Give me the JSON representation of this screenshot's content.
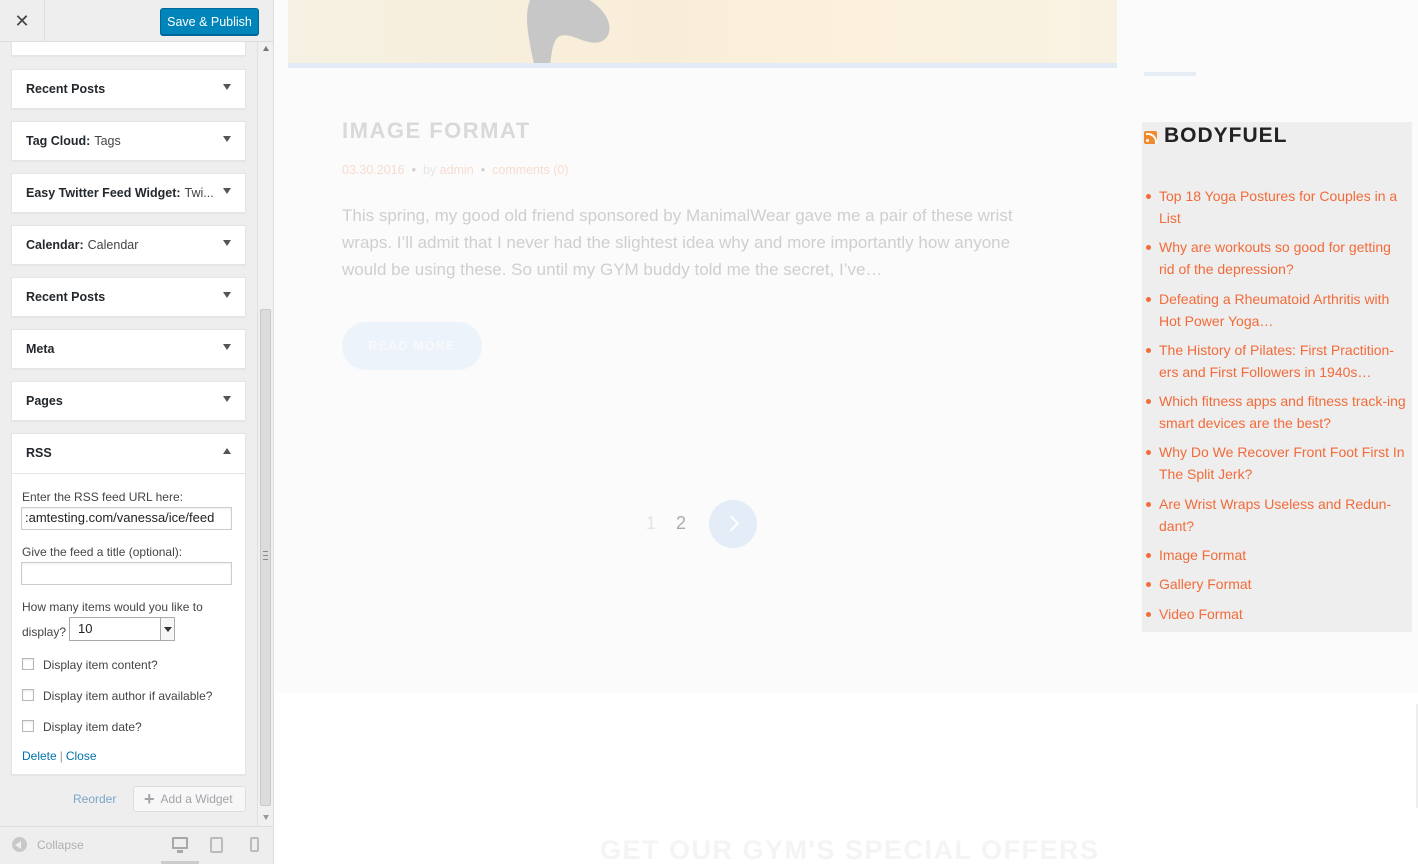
{
  "topbar": {
    "close_glyph": "✕",
    "save_label": "Save & Publish"
  },
  "widgets": [
    {
      "title": "Recent Posts",
      "subtitle": ""
    },
    {
      "title": "Tag Cloud:",
      "subtitle": "Tags"
    },
    {
      "title": "Easy Twitter Feed Widget:",
      "subtitle": "Twi..."
    },
    {
      "title": "Calendar:",
      "subtitle": "Calendar"
    },
    {
      "title": "Recent Posts",
      "subtitle": ""
    },
    {
      "title": "Meta",
      "subtitle": ""
    },
    {
      "title": "Pages",
      "subtitle": ""
    },
    {
      "title": "RSS",
      "subtitle": ""
    }
  ],
  "rss_form": {
    "url_label": "Enter the RSS feed URL here:",
    "url_value": ":amtesting.com/vanessa/ice/feed",
    "title_label": "Give the feed a title (optional):",
    "title_value": "",
    "items_label_1": "How many items would you like to",
    "items_label_2": "display?",
    "items_value": "10",
    "checkbox_content": "Display item content?",
    "checkbox_author": "Display item author if available?",
    "checkbox_date": "Display item date?",
    "delete_label": "Delete",
    "separator": "|",
    "close_label": "Close"
  },
  "sidebar_actions": {
    "reorder_label": "Reorder",
    "add_widget_label": "Add a Widget"
  },
  "footer": {
    "collapse_label": "Collapse"
  },
  "preview": {
    "post_title": "IMAGE FORMAT",
    "post_date": "03.30.2016",
    "post_by": "by",
    "post_author": "admin",
    "post_comments": "comments (0)",
    "post_excerpt": "This spring, my good old friend sponsored by ManimalWear gave me a pair of these wrist wraps. I’ll admit that I never had the slightest idea why and more importantly how anyone would be using these. So until my GYM buddy told me the secret, I’ve…",
    "read_more": "READ MORE",
    "pagination": {
      "page1": "1",
      "page2": "2"
    },
    "rss_widget_title": "BODYFUEL",
    "rss_items": [
      "Top 18 Yoga Postures for Couples in a List",
      "Why are workouts so good for getting rid of the depression?",
      "Defeating a Rheumatoid Arthritis with Hot Power Yoga…",
      "The History of Pilates: First Practition-ers and First Followers in 1940s…",
      "Which fitness apps and fitness track-ing smart devices are the best?",
      "Why Do We Recover Front Foot First In The Split Jerk?",
      "Are Wrist Wraps Useless and Redun-dant?",
      "Image Format",
      "Gallery Format",
      "Video Format"
    ],
    "offers_title": "GET OUR GYM'S SPECIAL OFFERS"
  },
  "colors": {
    "primary_button": "#0085ba",
    "link": "#0073aa",
    "rss_link": "#f26b3a"
  }
}
